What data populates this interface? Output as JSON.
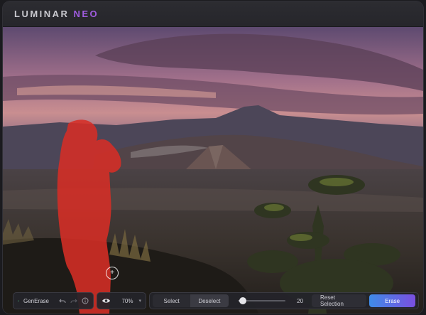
{
  "app": {
    "logo_word1": "LUMINAR",
    "logo_word2": "NEO",
    "accent_color": "#a05ce0"
  },
  "toolbar": {
    "tool_label": "GenErase",
    "tool_icon": "generase-icon",
    "undo_icon": "undo-icon",
    "redo_icon": "redo-icon",
    "info_icon": "info-icon",
    "visibility_icon": "eye-icon",
    "zoom_value": "70%",
    "select_label": "Select",
    "deselect_label": "Deselect",
    "brush_size_value": "20",
    "brush_size_fraction": 0.1,
    "reset_selection_label": "Reset Selection",
    "erase_label": "Erase",
    "erase_gradient": [
      "#3f8be8",
      "#7a4fe0"
    ]
  },
  "canvas": {
    "mask_color": "#d62e26",
    "brush_cursor_icon": "brush-cursor-icon"
  }
}
